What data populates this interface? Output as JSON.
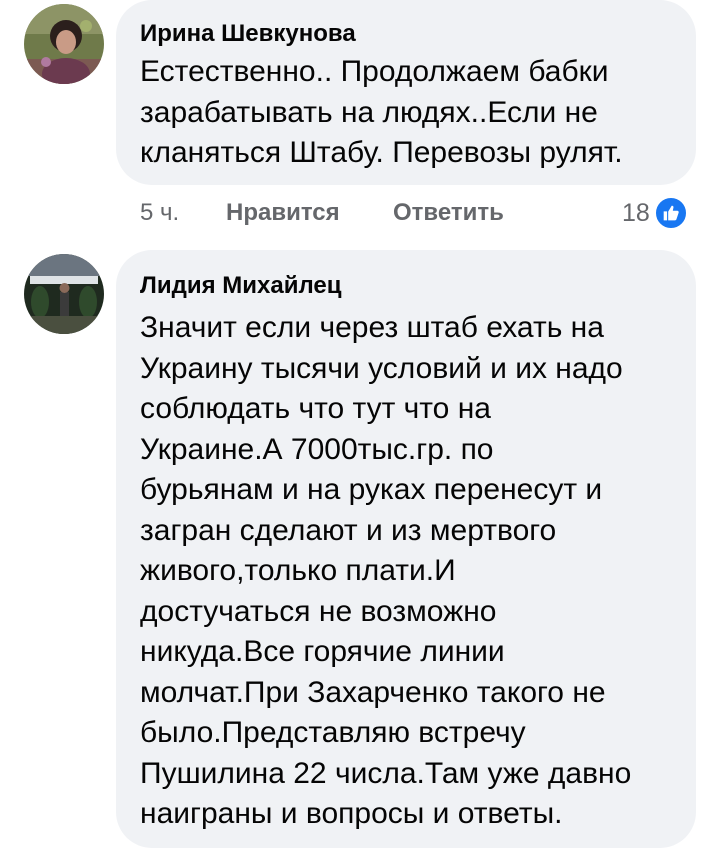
{
  "comments": [
    {
      "author": "Ирина Шевкунова",
      "text": "Естественно.. Продолжаем бабки\nзарабатывать на людях..Если не\nкланяться Штабу. Перевозы рулят.",
      "time": "5 ч.",
      "like_label": "Нравится",
      "reply_label": "Ответить",
      "reaction_count": "18",
      "reaction_icon": "like-icon"
    },
    {
      "author": "Лидия Михайлец",
      "text": "Значит если через штаб ехать на\nУкраину тысячи условий и их надо\nсоблюдать что тут что на\nУкраине.А 7000тыс.гр. по\nбурьянам и на руках перенесут и\nзагран сделают и из мертвого\nживого,только плати.И\nдостучаться не возможно\nникуда.Все горячие линии\nмолчат.При Захарченко такого не\nбыло.Представляю встречу\nПушилина 22 числа.Там уже давно\nнаиграны и вопросы и ответы."
    }
  ],
  "colors": {
    "bubble_bg": "#f0f2f5",
    "meta_text": "#65676b",
    "like_blue": "#1877f2"
  }
}
